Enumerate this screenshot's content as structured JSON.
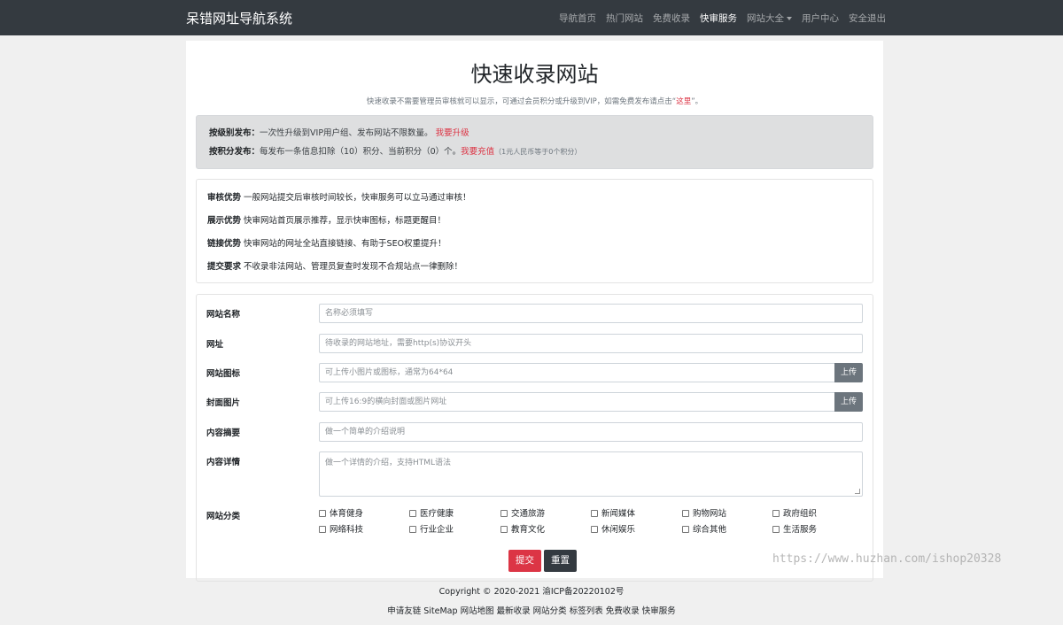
{
  "header": {
    "brand": "呆错网址导航系统",
    "nav": [
      {
        "label": "导航首页",
        "active": false
      },
      {
        "label": "热门网站",
        "active": false
      },
      {
        "label": "免费收录",
        "active": false
      },
      {
        "label": "快审服务",
        "active": true
      },
      {
        "label": "网站大全",
        "active": false,
        "dropdown": true
      },
      {
        "label": "用户中心",
        "active": false
      },
      {
        "label": "安全退出",
        "active": false
      }
    ]
  },
  "page": {
    "title": "快速收录网站",
    "subtitle_prefix": "快速收录不需要管理员审核就可以显示，可通过会员积分或升级到VIP，如需免费发布请点击“",
    "subtitle_link": "这里",
    "subtitle_suffix": "”。"
  },
  "alert": {
    "line1_label": "按级别发布：",
    "line1_text": "一次性升级到VIP用户组、发布网站不限数量。",
    "line1_link": "我要升级",
    "line2_label": "按积分发布：",
    "line2_text": "每发布一条信息扣除（10）积分、当前积分（0）个。",
    "line2_link": "我要充值",
    "line2_note": "（1元人民币等于0个积分）"
  },
  "advantages": [
    {
      "label": "审核优势",
      "text": "一般网站提交后审核时间较长，快审服务可以立马通过审核！"
    },
    {
      "label": "展示优势",
      "text": "快审网站首页展示推荐，显示快审图标，标题更醒目！"
    },
    {
      "label": "链接优势",
      "text": "快审网站的网址全站直接链接、有助于SEO权重提升！"
    },
    {
      "label": "提交要求",
      "text": "不收录非法网站、管理员复查时发现不合规站点一律删除！"
    }
  ],
  "form": {
    "name_label": "网站名称",
    "name_placeholder": "名称必须填写",
    "url_label": "网址",
    "url_placeholder": "待收录的网站地址，需要http(s)协议开头",
    "icon_label": "网站图标",
    "icon_placeholder": "可上传小图片或图标，通常为64*64",
    "cover_label": "封面图片",
    "cover_placeholder": "可上传16:9的横向封面或图片网址",
    "upload_label": "上传",
    "summary_label": "内容摘要",
    "summary_placeholder": "做一个简单的介绍说明",
    "detail_label": "内容详情",
    "detail_placeholder": "做一个详情的介绍，支持HTML语法",
    "category_label": "网站分类",
    "categories": [
      "体育健身",
      "医疗健康",
      "交通旅游",
      "新闻媒体",
      "购物网站",
      "政府组织",
      "网络科技",
      "行业企业",
      "教育文化",
      "休闲娱乐",
      "综合其他",
      "生活服务"
    ],
    "submit_label": "提交",
    "reset_label": "重置"
  },
  "footer": {
    "copyright": "Copyright © 2020-2021 渝ICP备20220102号",
    "links": [
      "申请友链",
      "SiteMap",
      "网站地图",
      "最新收录",
      "网站分类",
      "标签列表",
      "免费收录",
      "快审服务"
    ]
  },
  "watermark": "https://www.huzhan.com/ishop20328"
}
